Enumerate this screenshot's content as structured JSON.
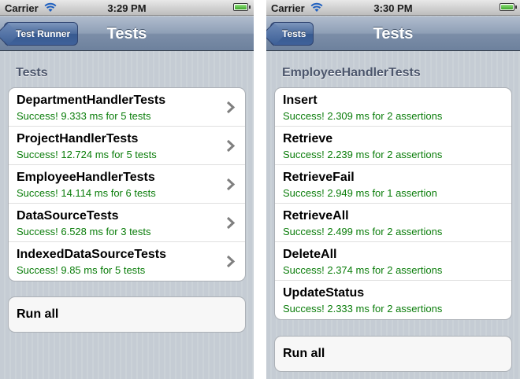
{
  "status": {
    "carrier": "Carrier",
    "time_left": "3:29 PM",
    "time_right": "3:30 PM"
  },
  "left": {
    "back_label": "Test Runner",
    "title": "Tests",
    "section": "Tests",
    "rows": [
      {
        "title": "DepartmentHandlerTests",
        "subtitle": "Success! 9.333 ms for 5 tests"
      },
      {
        "title": "ProjectHandlerTests",
        "subtitle": "Success! 12.724 ms for 5 tests"
      },
      {
        "title": "EmployeeHandlerTests",
        "subtitle": "Success! 14.114 ms for 6 tests"
      },
      {
        "title": "DataSourceTests",
        "subtitle": "Success! 6.528 ms for 3 tests"
      },
      {
        "title": "IndexedDataSourceTests",
        "subtitle": "Success! 9.85 ms for 5 tests"
      }
    ],
    "run_all": "Run all"
  },
  "right": {
    "back_label": "Tests",
    "title": "Tests",
    "section": "EmployeeHandlerTests",
    "rows": [
      {
        "title": "Insert",
        "subtitle": "Success! 2.309 ms for 2 assertions"
      },
      {
        "title": "Retrieve",
        "subtitle": "Success! 2.239 ms for 2 assertions"
      },
      {
        "title": "RetrieveFail",
        "subtitle": "Success! 2.949 ms for 1 assertion"
      },
      {
        "title": "RetrieveAll",
        "subtitle": "Success! 2.499 ms for 2 assertions"
      },
      {
        "title": "DeleteAll",
        "subtitle": "Success! 2.374 ms for 2 assertions"
      },
      {
        "title": "UpdateStatus",
        "subtitle": "Success! 2.333 ms for 2 assertions"
      }
    ],
    "run_all": "Run all"
  },
  "colors": {
    "success_text": "#0a7d0a",
    "navbar": "#7c8ea8",
    "background": "#c5ccd4"
  },
  "icons": {
    "status": [
      "wifi-icon",
      "battery-icon"
    ],
    "row_accessory": "chevron-right-icon"
  }
}
